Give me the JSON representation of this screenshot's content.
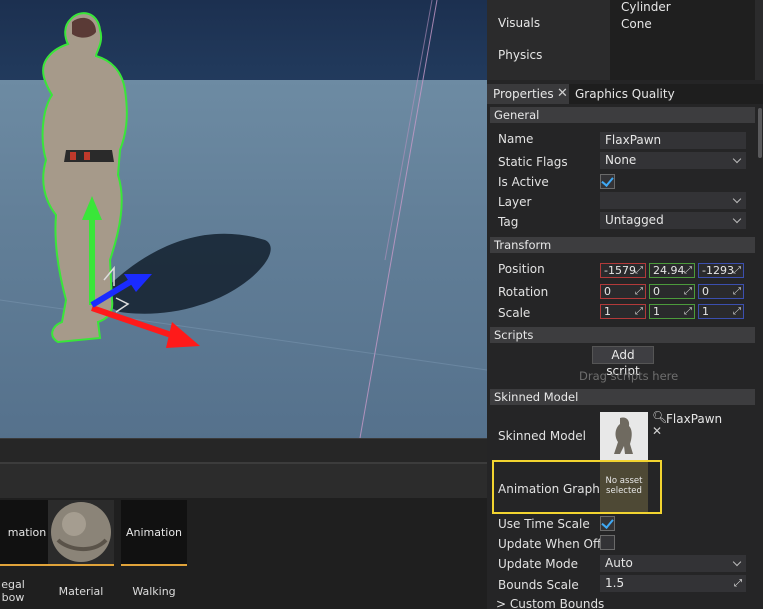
{
  "viewport": {},
  "content_panel": {
    "assets": [
      {
        "thumb_text": "mation",
        "label_line1": "egal",
        "label_line2": "bow"
      },
      {
        "thumb_text": "",
        "label_line1": "Material",
        "label_line2": ""
      },
      {
        "thumb_text": "Animation",
        "label_line1": "Walking",
        "label_line2": ""
      }
    ]
  },
  "toolbox": {
    "categories": [
      "Visuals",
      "Physics"
    ],
    "items": [
      "Cylinder",
      "Cone"
    ]
  },
  "tabs": {
    "properties": "Properties",
    "close_glyph": "✕",
    "graphics_quality": "Graphics Quality"
  },
  "properties": {
    "general": {
      "header": "General",
      "name_label": "Name",
      "name_value": "FlaxPawn",
      "static_flags_label": "Static Flags",
      "static_flags_value": "None",
      "is_active_label": "Is Active",
      "is_active": true,
      "layer_label": "Layer",
      "layer_value": "",
      "tag_label": "Tag",
      "tag_value": "Untagged"
    },
    "transform": {
      "header": "Transform",
      "position_label": "Position",
      "position": [
        "-1579",
        "24.94",
        "-1293"
      ],
      "rotation_label": "Rotation",
      "rotation": [
        "0",
        "0",
        "0"
      ],
      "scale_label": "Scale",
      "scale": [
        "1",
        "1",
        "1"
      ]
    },
    "scripts": {
      "header": "Scripts",
      "add_script": "Add script",
      "drag_hint": "Drag scripts here"
    },
    "skinned_model": {
      "header": "Skinned Model",
      "skinned_model_label": "Skinned Model",
      "skinned_model_value": "FlaxPawn",
      "animation_graph_label": "Animation Graph",
      "no_asset_line1": "No asset",
      "no_asset_line2": "selected",
      "use_time_scale_label": "Use Time Scale",
      "use_time_scale": true,
      "update_when_offscreen_label": "Update When Offs",
      "update_when_offscreen": false,
      "update_mode_label": "Update Mode",
      "update_mode_value": "Auto",
      "bounds_scale_label": "Bounds Scale",
      "bounds_scale_value": "1.5",
      "custom_bounds_label": "> Custom Bounds"
    }
  },
  "colors": {
    "highlight": "#f2d430",
    "accent": "#3fa9f5",
    "axis_x": "#ff1a1a",
    "axis_y": "#39e639",
    "axis_z": "#1a2bff"
  }
}
